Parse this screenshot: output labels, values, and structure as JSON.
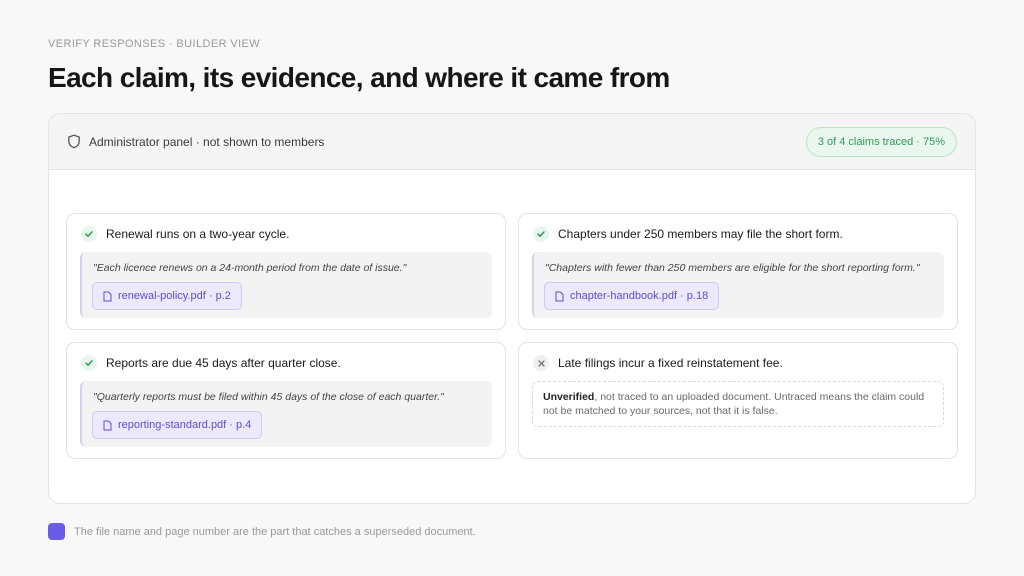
{
  "header": {
    "eyebrow": "VERIFY RESPONSES · BUILDER VIEW",
    "title": "Each claim, its evidence, and where it came from"
  },
  "panel": {
    "admin_label": "Administrator panel · not shown to members",
    "admin_icon": "shield-icon",
    "progress_label": "3 of 4 claims traced · 75%",
    "traced": 3,
    "total": 4,
    "percent": 75
  },
  "claims": [
    {
      "text": "Renewal runs on a two-year cycle.",
      "status": "traced",
      "quote": "\"Each licence renews on a 24-month period from the date of issue.\"",
      "source": "renewal-policy.pdf · p.2"
    },
    {
      "text": "Chapters under 250 members may file the short form.",
      "status": "traced",
      "quote": "\"Chapters with fewer than 250 members are eligible for the short reporting form.\"",
      "source": "chapter-handbook.pdf · p.18"
    },
    {
      "text": "Reports are due 45 days after quarter close.",
      "status": "traced",
      "quote": "\"Quarterly reports must be filed within 45 days of the close of each quarter.\"",
      "source": "reporting-standard.pdf · p.4"
    },
    {
      "text": "Late filings incur a fixed reinstatement fee.",
      "status": "unverified",
      "unverified_label": "Unverified",
      "unverified_note": ", not traced to an uploaded document. Untraced means the claim could not be matched to your sources, not that it is false."
    }
  ],
  "legend": {
    "text": "The file name and page number are the part that catches a superseded document."
  },
  "colors": {
    "accent": "#6b5ce7",
    "success": "#2e9c58",
    "source_text": "#5b4fd1"
  }
}
